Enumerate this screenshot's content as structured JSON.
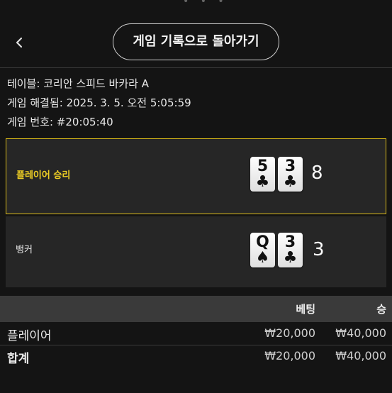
{
  "header": {
    "back_icon": "chevron-left-icon",
    "history_button_label": "게임 기록으로 돌아가기"
  },
  "info": {
    "table": "테이블: 코리안 스피드 바카라 A",
    "resolved_time": "게임 해결됨: 2025. 3. 5. 오전 5:05:59",
    "game_number": "게임 번호: #20:05:40"
  },
  "result": {
    "player": {
      "label": "플레이어 승리",
      "cards": [
        {
          "rank": "5",
          "suit": "♣"
        },
        {
          "rank": "3",
          "suit": "♣"
        }
      ],
      "score": "8"
    },
    "banker": {
      "label": "뱅커",
      "cards": [
        {
          "rank": "Q",
          "suit": "♠"
        },
        {
          "rank": "3",
          "suit": "♣"
        }
      ],
      "score": "3"
    }
  },
  "bets": {
    "header": {
      "bet": "베팅",
      "win": "승"
    },
    "rows": [
      {
        "name": "플레이어",
        "bet": "₩20,000",
        "win": "₩40,000"
      }
    ],
    "total": {
      "name": "합계",
      "bet": "₩20,000",
      "win": "₩40,000"
    }
  },
  "colors": {
    "winner_accent": "#d9b918",
    "background": "#141414",
    "panel": "#262626"
  }
}
